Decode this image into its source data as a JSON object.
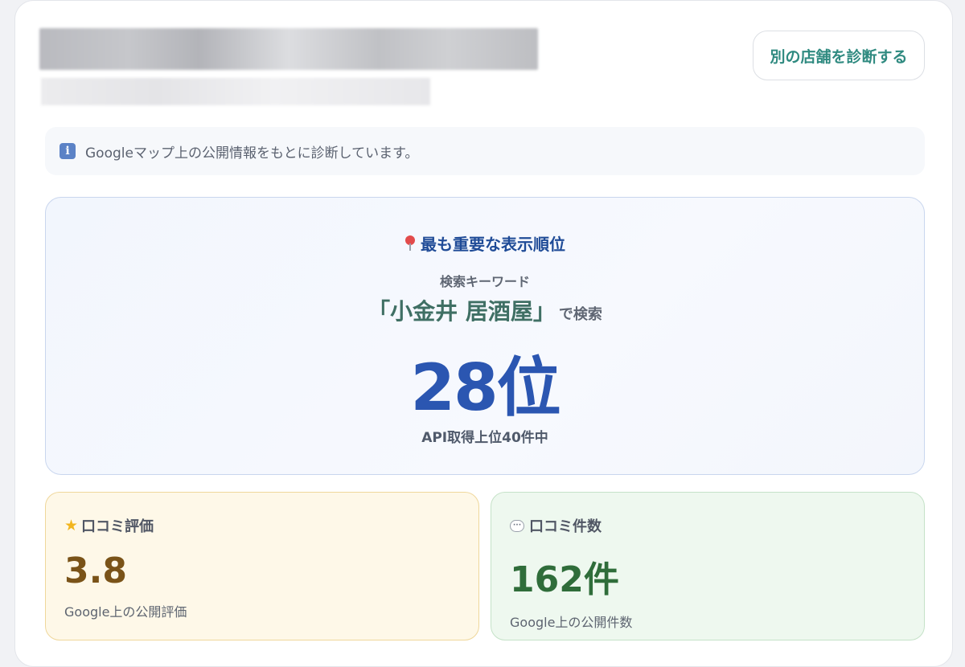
{
  "header": {
    "action_button": "別の店舗を診断する"
  },
  "notice": {
    "icon": "info-icon",
    "text": "Googleマップ上の公開情報をもとに診断しています。"
  },
  "ranking": {
    "icon": "map-pin-icon",
    "heading": "最も重要な表示順位",
    "keyword_label": "検索キーワード",
    "keyword": "「小金井 居酒屋」",
    "keyword_suffix": "で検索",
    "rank": "28位",
    "note": "API取得上位40件中"
  },
  "rating_card": {
    "icon": "star-icon",
    "label": "口コミ評価",
    "value": "3.8",
    "caption": "Google上の公開評価"
  },
  "review_count_card": {
    "icon": "speech-bubble-icon",
    "label": "口コミ件数",
    "value": "162件",
    "caption": "Google上の公開件数"
  },
  "colors": {
    "accent_teal": "#2f8a80",
    "rank_blue": "#2b56b1",
    "rating_brown": "#7a5318",
    "count_green": "#2f6d3a"
  }
}
